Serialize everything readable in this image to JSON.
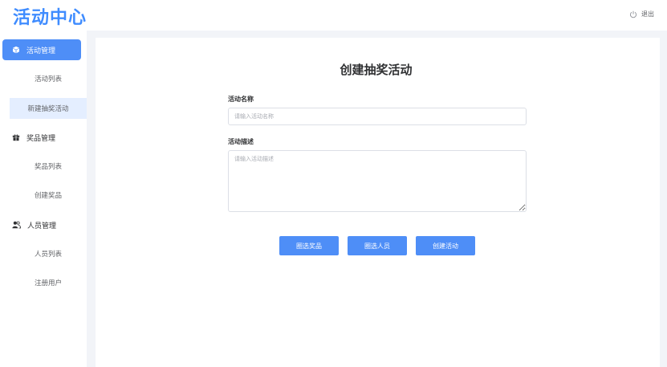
{
  "header": {
    "logo": "活动中心",
    "logout_label": "退出",
    "logout_icon": "power-icon"
  },
  "sidebar": {
    "groups": [
      {
        "label": "活动管理",
        "icon": "cube-icon",
        "items": [
          "活动列表",
          "新建抽奖活动"
        ]
      },
      {
        "label": "奖品管理",
        "icon": "gift-icon",
        "items": [
          "奖品列表",
          "创建奖品"
        ]
      },
      {
        "label": "人员管理",
        "icon": "users-icon",
        "items": [
          "人员列表",
          "注册用户"
        ]
      }
    ]
  },
  "main": {
    "title": "创建抽奖活动",
    "name_label": "活动名称",
    "name_placeholder": "请输入活动名称",
    "name_value": "",
    "desc_label": "活动描述",
    "desc_placeholder": "请输入活动描述",
    "desc_value": "",
    "buttons": {
      "select_prizes": "圈选奖品",
      "select_people": "圈选人员",
      "create": "创建活动"
    }
  },
  "colors": {
    "accent": "#4e8ef7",
    "logo": "#3f8cff",
    "active_item_bg": "#e4eeff",
    "content_bg": "#f2f4f8"
  }
}
